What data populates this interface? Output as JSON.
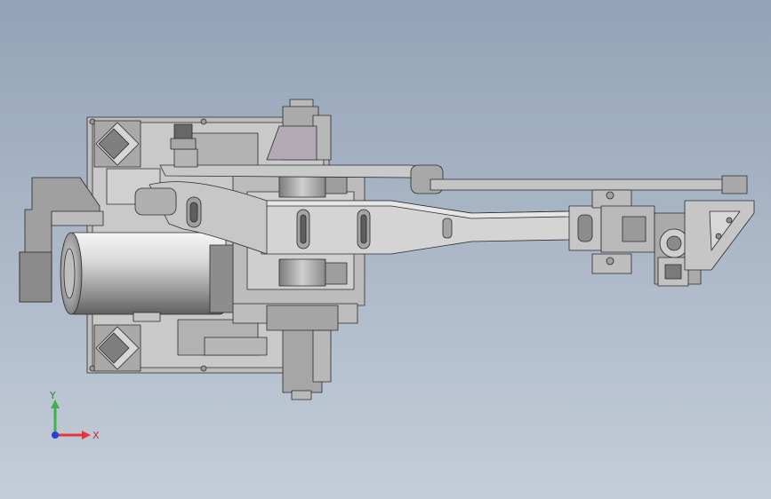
{
  "viewport": {
    "background_top": "#93a3b7",
    "background_bottom": "#c4cdd9"
  },
  "model": {
    "part_fill_light": "#d4d4d4",
    "part_fill_mid": "#bdbdbd",
    "part_fill_dark": "#8f8f8f",
    "accent_fill": "#b4aab6",
    "edge_color": "#2b2b2b"
  },
  "triad": {
    "x_label": "X",
    "y_label": "Y",
    "x_color": "#e8333a",
    "y_color": "#3fb34a",
    "z_color": "#2a3fd8"
  }
}
